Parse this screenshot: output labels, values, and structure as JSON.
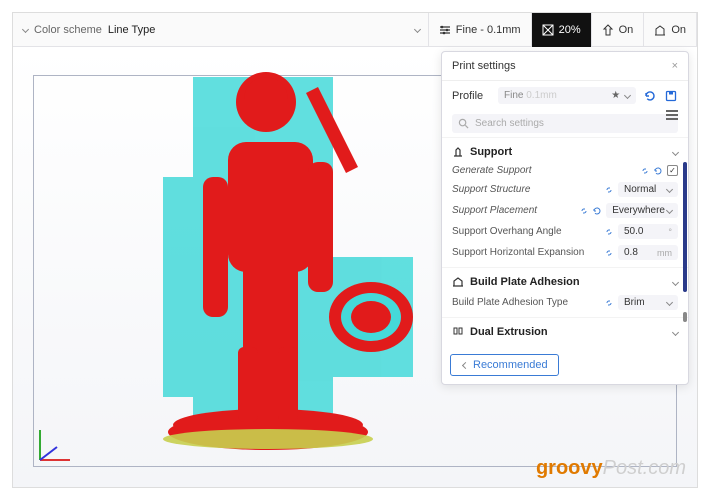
{
  "topbar": {
    "color_scheme_label": "Color scheme",
    "color_scheme_value": "Line Type"
  },
  "tools": {
    "quality": "Fine - 0.1mm",
    "infill": "20%",
    "support": "On",
    "adhesion": "On"
  },
  "panel": {
    "title": "Print settings",
    "profile_label": "Profile",
    "profile_value": "Fine",
    "profile_hint": "0.1mm",
    "search_placeholder": "Search settings"
  },
  "sections": {
    "support": {
      "title": "Support",
      "generate": {
        "label": "Generate Support",
        "checked": true
      },
      "structure": {
        "label": "Support Structure",
        "value": "Normal"
      },
      "placement": {
        "label": "Support Placement",
        "value": "Everywhere"
      },
      "overhang": {
        "label": "Support Overhang Angle",
        "value": "50.0"
      },
      "horizexp": {
        "label": "Support Horizontal Expansion",
        "value": "0.8",
        "unit": "mm"
      }
    },
    "adhesion": {
      "title": "Build Plate Adhesion",
      "type": {
        "label": "Build Plate Adhesion Type",
        "value": "Brim"
      }
    },
    "dual": {
      "title": "Dual Extrusion"
    }
  },
  "recommended": "Recommended",
  "watermark": "Post.com",
  "watermark_brand": "groovy"
}
